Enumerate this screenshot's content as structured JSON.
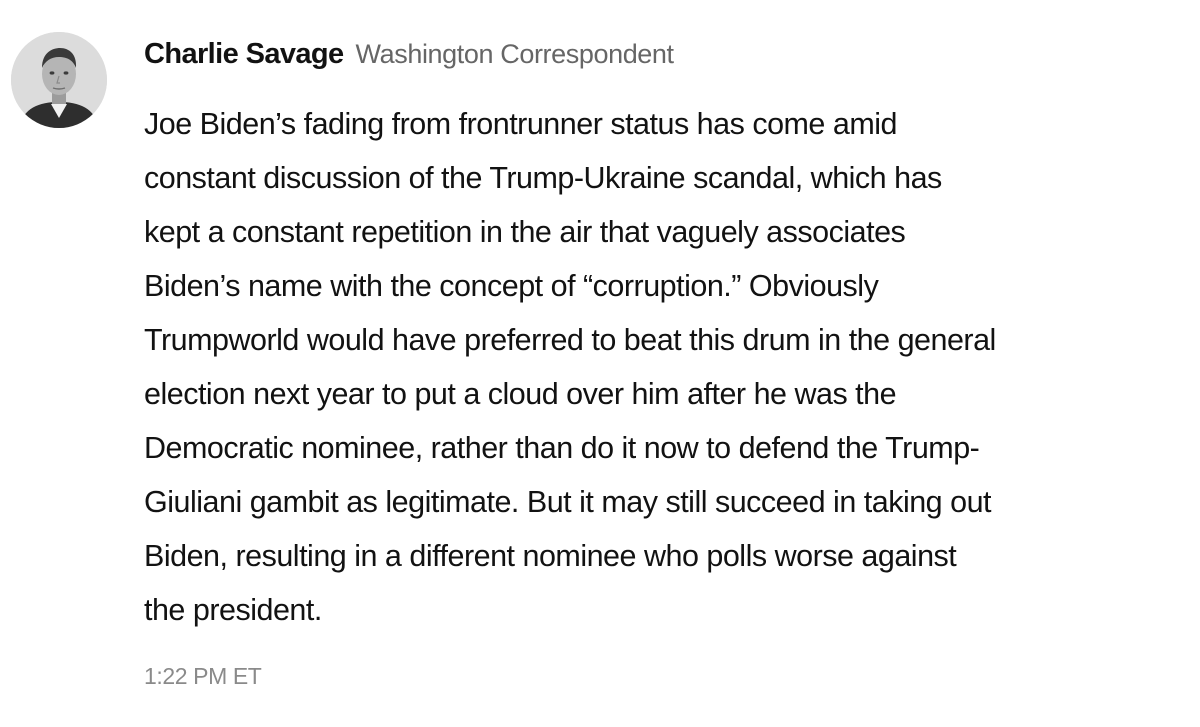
{
  "post": {
    "author": {
      "avatar_icon": "author-portrait",
      "name": "Charlie Savage",
      "title": "Washington Correspondent"
    },
    "body_lines": [
      "Joe Biden’s fading from frontrunner status has come amid",
      "constant discussion of the Trump-Ukraine scandal, which has",
      "kept a constant repetition in the air that vaguely associates",
      "Biden’s name with the concept of “corruption.” Obviously",
      "Trumpworld would have preferred to beat this drum in the general",
      "election next year to put a cloud over him after he was the",
      "Democratic nominee, rather than do it now to defend the Trump-",
      "Giuliani gambit as legitimate. But it may still succeed in taking out",
      "Biden, resulting in a different nominee who polls worse against",
      "the president."
    ],
    "timestamp": "1:22 PM ET"
  }
}
